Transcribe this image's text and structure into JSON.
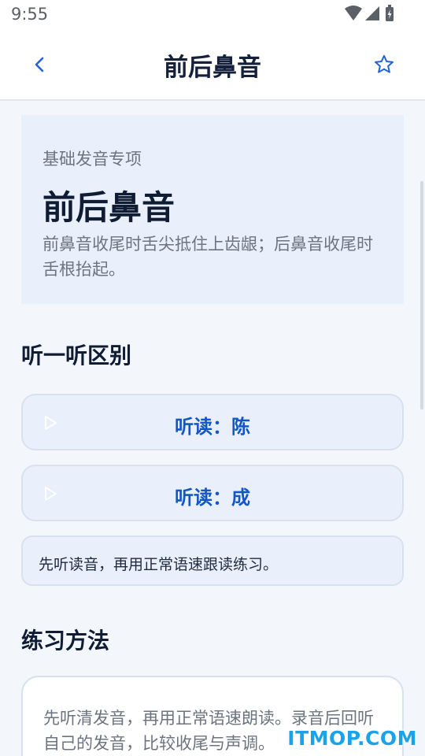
{
  "status_bar": {
    "time": "9:55",
    "icons": [
      "wifi-icon",
      "cellular-signal-icon",
      "battery-charging-icon"
    ]
  },
  "app_bar": {
    "title": "前后鼻音",
    "back_icon": "chevron-left-icon",
    "favorite_icon": "star-outline-icon"
  },
  "hero": {
    "kicker": "基础发音专项",
    "title": "前后鼻音",
    "description": "前鼻音收尾时舌尖抵住上齿龈；后鼻音收尾时舌根抬起。"
  },
  "listen_section": {
    "title": "听一听区别",
    "buttons": [
      {
        "label": "听读：陈",
        "icon": "play-icon"
      },
      {
        "label": "听读：成",
        "icon": "play-icon"
      }
    ],
    "tip": "先听读音，再用正常语速跟读练习。"
  },
  "method_section": {
    "title": "练习方法",
    "text": "先听清发音，再用正常语速朗读。录音后回听自己的发音，比较收尾与声调。"
  },
  "watermark": "ITMOP.COM",
  "colors": {
    "accent": "#1556c7",
    "card_background": "#e9f0fc",
    "page_background": "#f3f6fb",
    "watermark": "#1aa3e8"
  }
}
